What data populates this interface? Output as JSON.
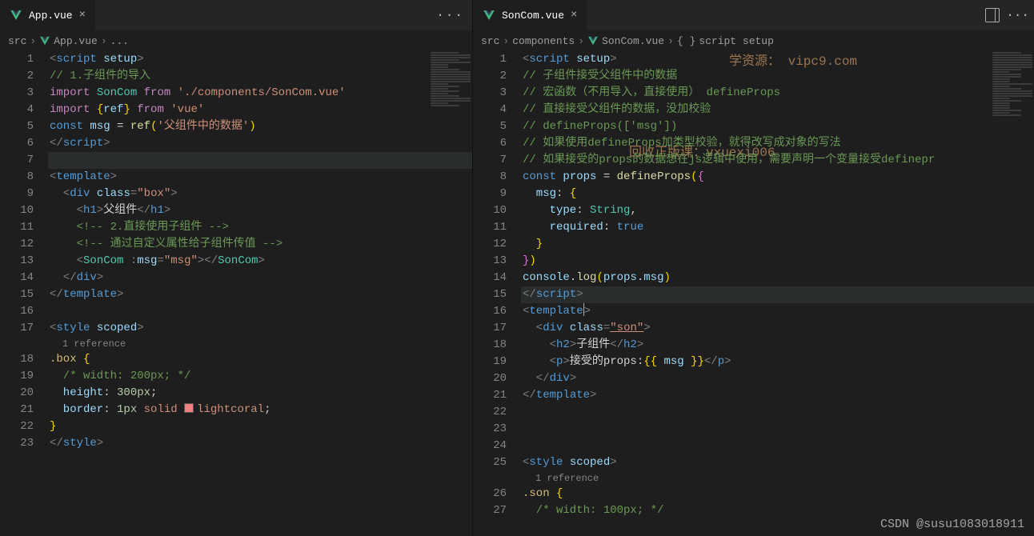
{
  "left": {
    "tab": {
      "file": "App.vue"
    },
    "breadcrumb": {
      "p0": "src",
      "p1": "App.vue",
      "p2": "..."
    },
    "numbers": [
      "1",
      "2",
      "3",
      "4",
      "5",
      "6",
      "7",
      "8",
      "9",
      "10",
      "11",
      "12",
      "13",
      "14",
      "15",
      "16",
      "17",
      "18",
      "19",
      "20",
      "21",
      "22",
      "23"
    ],
    "ref": "1 reference",
    "c": {
      "l1a": "<",
      "l1b": "script",
      "l1c": " setup",
      "l1d": ">",
      "l2a": "// 1.子组件的导入",
      "l3a": "import ",
      "l3b": "SonCom",
      "l3c": " from ",
      "l3d": "'./components/SonCom.vue'",
      "l4a": "import ",
      "l4b": "{",
      "l4c": "ref",
      "l4d": "}",
      "l4e": " from ",
      "l4f": "'vue'",
      "l5a": "const ",
      "l5b": "msg",
      "l5c": " = ",
      "l5d": "ref",
      "l5e": "(",
      "l5f": "'父组件中的数据'",
      "l5g": ")",
      "l6a": "</",
      "l6b": "script",
      "l6c": ">",
      "l8a": "<",
      "l8b": "template",
      "l8c": ">",
      "l9a": "  <",
      "l9b": "div",
      "l9c": " class",
      "l9d": "=",
      "l9e": "\"box\"",
      "l9f": ">",
      "l10a": "    <",
      "l10b": "h1",
      "l10c": ">",
      "l10d": "父组件",
      "l10e": "</",
      "l10f": "h1",
      "l10g": ">",
      "l11a": "    <!-- 2.直接使用子组件 -->",
      "l12a": "    <!-- 通过自定义属性给子组件传值 -->",
      "l13a": "    <",
      "l13b": "SonCom",
      "l13c": " :",
      "l13d": "msg",
      "l13e": "=",
      "l13f": "\"msg\"",
      "l13g": ">",
      "l13h": "</",
      "l13i": "SonCom",
      "l13j": ">",
      "l14a": "  </",
      "l14b": "div",
      "l14c": ">",
      "l15a": "</",
      "l15b": "template",
      "l15c": ">",
      "l17a": "<",
      "l17b": "style",
      "l17c": " scoped",
      "l17d": ">",
      "l18a": ".box ",
      "l18b": "{",
      "l19a": "  /* width: 200px; */",
      "l20a": "  height",
      "l20b": ": ",
      "l20c": "300px",
      "l20d": ";",
      "l21a": "  border",
      "l21b": ": ",
      "l21c": "1px",
      "l21d": " solid ",
      "l21e": "lightcoral",
      "l21f": ";",
      "l22a": "}",
      "l23a": "</",
      "l23b": "style",
      "l23c": ">"
    }
  },
  "right": {
    "tab": {
      "file": "SonCom.vue"
    },
    "breadcrumb": {
      "p0": "src",
      "p1": "components",
      "p2": "SonCom.vue",
      "p3": "script setup"
    },
    "watermark1": "学资源：  vipc9.com",
    "watermark2": "回收正版课：vxuexi006",
    "csdn": "CSDN @susu1083018911",
    "numbers": [
      "1",
      "2",
      "3",
      "4",
      "5",
      "6",
      "7",
      "8",
      "9",
      "10",
      "11",
      "12",
      "13",
      "14",
      "15",
      "16",
      "17",
      "18",
      "19",
      "20",
      "21",
      "22",
      "23",
      "24",
      "25",
      "26",
      "27"
    ],
    "ref": "1 reference",
    "c": {
      "l1a": "<",
      "l1b": "script",
      "l1c": " setup",
      "l1d": ">",
      "l2a": "// 子组件接受父组件中的数据",
      "l3a": "// 宏函数（不用导入，直接使用） defineProps",
      "l4a": "// 直接接受父组件的数据，没加校验",
      "l5a": "// defineProps(['msg'])",
      "l6a": "// 如果使用defineProps加类型校验，就得改写成对象的写法",
      "l7a": "// 如果接受的props的数据想在js逻辑中使用，需要声明一个变量接受definepr",
      "l8a": "const ",
      "l8b": "props",
      "l8c": " = ",
      "l8d": "defineProps",
      "l8e": "(",
      "l8f": "{",
      "l9a": "  msg",
      "l9b": ": ",
      "l9c": "{",
      "l10a": "    type",
      "l10b": ": ",
      "l10c": "String",
      "l10d": ",",
      "l11a": "    required",
      "l11b": ": ",
      "l11c": "true",
      "l12a": "  }",
      "l13a": "}",
      "l13b": ")",
      "l14a": "console",
      "l14b": ".",
      "l14c": "log",
      "l14d": "(",
      "l14e": "props",
      "l14f": ".",
      "l14g": "msg",
      "l14h": ")",
      "l15a": "</",
      "l15b": "script",
      "l15c": ">",
      "l16a": "<",
      "l16b": "template",
      "l16c": ">",
      "l17a": "  <",
      "l17b": "div",
      "l17c": " class",
      "l17d": "=",
      "l17e": "\"son\"",
      "l17f": ">",
      "l18a": "    <",
      "l18b": "h2",
      "l18c": ">",
      "l18d": "子组件",
      "l18e": "</",
      "l18f": "h2",
      "l18g": ">",
      "l19a": "    <",
      "l19b": "p",
      "l19c": ">",
      "l19d": "接受的props:",
      "l19e": "{{ ",
      "l19f": "msg",
      "l19g": " }}",
      "l19h": "</",
      "l19i": "p",
      "l19j": ">",
      "l20a": "  </",
      "l20b": "div",
      "l20c": ">",
      "l21a": "</",
      "l21b": "template",
      "l21c": ">",
      "l25a": "<",
      "l25b": "style",
      "l25c": " scoped",
      "l25d": ">",
      "l26a": ".son ",
      "l26b": "{",
      "l27a": "  /* width: 100px; */"
    }
  }
}
